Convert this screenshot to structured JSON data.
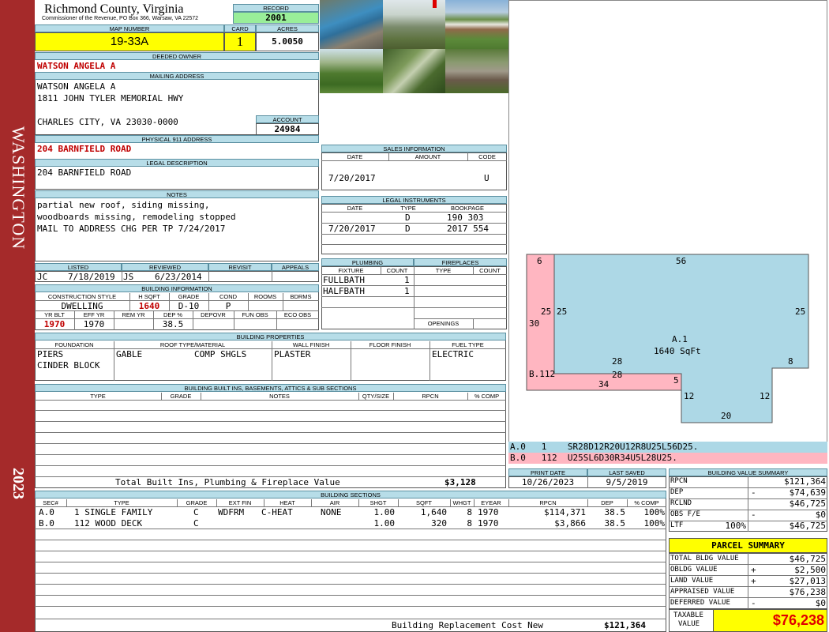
{
  "side": {
    "name": "WASHINGTON",
    "year": "2023"
  },
  "header": {
    "county": "Richmond County, Virginia",
    "commissioner": "Commissioner of the Revenue, PO Box 366, Warsaw, VA 22572",
    "record_label": "RECORD",
    "record": "2001",
    "map_label": "MAP NUMBER",
    "map": "19-33A",
    "card_label": "CARD",
    "card": "1",
    "acres_label": "ACRES",
    "acres": "5.0050"
  },
  "owner": {
    "label": "DEEDED OWNER",
    "name": "WATSON ANGELA A"
  },
  "mailing": {
    "label": "MAILING ADDRESS",
    "line1": "WATSON ANGELA A",
    "line2": "1811 JOHN TYLER MEMORIAL HWY",
    "line3": "CHARLES CITY, VA 23030-0000",
    "account_label": "ACCOUNT",
    "account": "24984"
  },
  "physical": {
    "label": "PHYSICAL 911 ADDRESS",
    "value": "204 BARNFIELD ROAD"
  },
  "legal": {
    "label": "LEGAL DESCRIPTION",
    "value": "204 BARNFIELD ROAD"
  },
  "notes": {
    "label": "NOTES",
    "line1": "partial new roof, siding missing,",
    "line2": "woodboards missing, remodeling stopped",
    "line3": "MAIL TO ADDRESS CHG PER TP 7/24/2017"
  },
  "listed": {
    "listed_label": "LISTED",
    "reviewed_label": "REVIEWED",
    "revisit_label": "REVISIT",
    "appeals_label": "APPEALS",
    "listed_by": "JC",
    "listed_date": "7/18/2019",
    "reviewed_by": "JS",
    "reviewed_date": "6/23/2014"
  },
  "building_info": {
    "label": "BUILDING INFORMATION",
    "h_cs": "CONSTRUCTION STYLE",
    "h_sqft": "H SQFT",
    "h_grade": "GRADE",
    "h_cond": "COND",
    "h_rooms": "ROOMS",
    "h_bdrms": "BDRMS",
    "style": "DWELLING",
    "sqft": "1640",
    "grade": "D-10",
    "cond": "P",
    "h_yrblt": "YR BLT",
    "h_effyr": "EFF YR",
    "h_remyr": "REM YR",
    "h_dep": "DEP %",
    "h_depovr": "DEPOVR",
    "h_funobs": "FUN OBS",
    "h_ecoobs": "ECO OBS",
    "yrblt": "1970",
    "effyr": "1970",
    "dep": "38.5"
  },
  "props": {
    "label": "BUILDING PROPERTIES",
    "h_found": "FOUNDATION",
    "h_roof": "ROOF TYPE/MATERIAL",
    "h_wall": "WALL FINISH",
    "h_floor": "FLOOR FINISH",
    "h_fuel": "FUEL TYPE",
    "found1": "PIERS",
    "found2": "CINDER BLOCK",
    "roof_type": "GABLE",
    "roof_mat": "COMP SHGLS",
    "wall": "PLASTER",
    "fuel": "ELECTRIC"
  },
  "builtins": {
    "label": "BUILDING BUILT INS, BASEMENTS, ATTICS & SUB SECTIONS",
    "h_type": "TYPE",
    "h_grade": "GRADE",
    "h_notes": "NOTES",
    "h_qty": "QTY/SIZE",
    "h_rpcn": "RPCN",
    "h_pct": "% COMP",
    "total_label": "Total Built Ins, Plumbing & Fireplace Value",
    "total": "$3,128"
  },
  "sales": {
    "label": "SALES INFORMATION",
    "h_date": "DATE",
    "h_amount": "AMOUNT",
    "h_code": "CODE",
    "date": "7/20/2017",
    "code": "U"
  },
  "instruments": {
    "label": "LEGAL INSTRUMENTS",
    "h_date": "DATE",
    "h_type": "TYPE",
    "h_book": "BOOKPAGE",
    "rows": [
      {
        "date": "",
        "type": "D",
        "book": "190 303"
      },
      {
        "date": "7/20/2017",
        "type": "D",
        "book": "2017 554"
      }
    ]
  },
  "plumbing": {
    "label": "PLUMBING",
    "h_fixture": "FIXTURE",
    "h_count": "COUNT",
    "rows": [
      {
        "fixture": "FULLBATH",
        "count": "1"
      },
      {
        "fixture": "HALFBATH",
        "count": "1"
      }
    ]
  },
  "fireplaces": {
    "label": "FIREPLACES",
    "h_type": "TYPE",
    "h_count": "COUNT",
    "openings": "OPENINGS"
  },
  "sketch": {
    "section_a": "A.1",
    "sqft": "1640 SqFt",
    "section_b": "B.112",
    "dims": [
      "6",
      "56",
      "25",
      "25",
      "25",
      "30",
      "28",
      "28",
      "34",
      "8",
      "5",
      "12",
      "12",
      "20"
    ],
    "code_a": "A.0   1    SR28D12R20U12R8U25L56D25.",
    "code_b": "B.0   112  U25SL6D30R34U5L28U25."
  },
  "print": {
    "h_print": "PRINT DATE",
    "h_saved": "LAST SAVED",
    "print_date": "10/26/2023",
    "saved_date": "9/5/2019"
  },
  "sections": {
    "label": "BUILDING SECTIONS",
    "headers": [
      "SEC#",
      "TYPE",
      "GRADE",
      "EXT FIN",
      "HEAT",
      "AIR",
      "SHGT",
      "SQFT",
      "WHGT",
      "EYEAR",
      "RPCN",
      "DEP",
      "% COMP"
    ],
    "rows": [
      {
        "sec": "A.0",
        "type": "1 SINGLE FAMILY",
        "grade": "C",
        "ext": "WDFRM",
        "heat": "C-HEAT",
        "air": "NONE",
        "shgt": "1.00",
        "sqft": "1,640",
        "whgt": "8",
        "eyear": "1970",
        "rpcn": "$114,371",
        "dep": "38.5",
        "pct": "100%"
      },
      {
        "sec": "B.0",
        "type": "112 WOOD DECK",
        "grade": "C",
        "ext": "",
        "heat": "",
        "air": "",
        "shgt": "1.00",
        "sqft": "320",
        "whgt": "8",
        "eyear": "1970",
        "rpcn": "$3,866",
        "dep": "38.5",
        "pct": "100%"
      }
    ],
    "replacement_label": "Building Replacement Cost New",
    "replacement": "$121,364"
  },
  "value_summary": {
    "label": "BUILDING VALUE SUMMARY",
    "rows": [
      {
        "k": "RPCN",
        "sign": "",
        "v": "$121,364"
      },
      {
        "k": "DEP",
        "sign": "-",
        "v": "$74,639"
      },
      {
        "k": "RCLND",
        "sign": "",
        "v": "$46,725"
      },
      {
        "k": "OBS F/E",
        "sign": "-",
        "v": "$0"
      },
      {
        "k": "LTF",
        "sign": "100%",
        "v": "$46,725"
      }
    ]
  },
  "parcel": {
    "label": "PARCEL SUMMARY",
    "rows": [
      {
        "k": "TOTAL BLDG VALUE",
        "sign": "",
        "v": "$46,725"
      },
      {
        "k": "OBLDG VALUE",
        "sign": "+",
        "v": "$2,500"
      },
      {
        "k": "LAND VALUE",
        "sign": "+",
        "v": "$27,013"
      },
      {
        "k": "APPRAISED VALUE",
        "sign": "",
        "v": "$76,238"
      },
      {
        "k": "DEFERRED VALUE",
        "sign": "-",
        "v": "$0"
      }
    ],
    "taxable_label1": "TAXABLE",
    "taxable_label2": "VALUE",
    "taxable": "$76,238"
  },
  "colors": {
    "sidebar": "#a52a2a",
    "header": "#b7dde8",
    "yellow": "#ffff00",
    "green": "#99ee99",
    "sketch_a": "#add8e6",
    "sketch_b": "#ffb6c1"
  }
}
